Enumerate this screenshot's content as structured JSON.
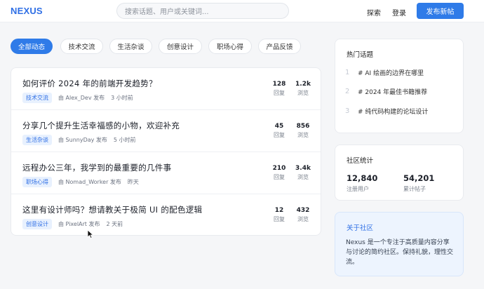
{
  "header": {
    "logo": "NEXUS",
    "search_placeholder": "搜索话题、用户或关键词...",
    "nav_explore": "探索",
    "nav_login": "登录",
    "publish_label": "发布新帖"
  },
  "tabs": [
    {
      "label": "全部动态",
      "active": true
    },
    {
      "label": "技术交流",
      "active": false
    },
    {
      "label": "生活杂谈",
      "active": false
    },
    {
      "label": "创意设计",
      "active": false
    },
    {
      "label": "职场心得",
      "active": false
    },
    {
      "label": "产品反馈",
      "active": false
    }
  ],
  "posts": [
    {
      "title": "如何评价 2024 年的前端开发趋势？",
      "tag": "技术交流",
      "author": "由 Alex_Dev 发布",
      "time": "3 小时前",
      "replies": "128",
      "replies_label": "回复",
      "views": "1.2k",
      "views_label": "浏览"
    },
    {
      "title": "分享几个提升生活幸福感的小物，欢迎补充",
      "tag": "生活杂谈",
      "author": "由 SunnyDay 发布",
      "time": "5 小时前",
      "replies": "45",
      "replies_label": "回复",
      "views": "856",
      "views_label": "浏览"
    },
    {
      "title": "远程办公三年，我学到的最重要的几件事",
      "tag": "职场心得",
      "author": "由 Nomad_Worker 发布",
      "time": "昨天",
      "replies": "210",
      "replies_label": "回复",
      "views": "3.4k",
      "views_label": "浏览"
    },
    {
      "title": "这里有设计师吗？想请教关于极简 UI 的配色逻辑",
      "tag": "创意设计",
      "author": "由 PixelArt 发布",
      "time": "2 天前",
      "replies": "12",
      "replies_label": "回复",
      "views": "432",
      "views_label": "浏览"
    }
  ],
  "hot_topics": {
    "title": "热门话题",
    "items": [
      {
        "rank": "1",
        "label": "# AI 绘画的边界在哪里"
      },
      {
        "rank": "2",
        "label": "# 2024 年最佳书籍推荐"
      },
      {
        "rank": "3",
        "label": "# 纯代码构建的论坛设计"
      }
    ]
  },
  "community_stats": {
    "title": "社区统计",
    "users_value": "12,840",
    "users_label": "注册用户",
    "posts_value": "54,201",
    "posts_label": "累计帖子"
  },
  "about": {
    "title": "关于社区",
    "text": "Nexus 是一个专注于高质量内容分享与讨论的简约社区。保持礼貌，理性交流。"
  },
  "colors": {
    "accent": "#2f7be8",
    "badge_bg": "#e8f1fe",
    "page_bg": "#f5f6f8",
    "about_bg": "#edf4fe"
  }
}
